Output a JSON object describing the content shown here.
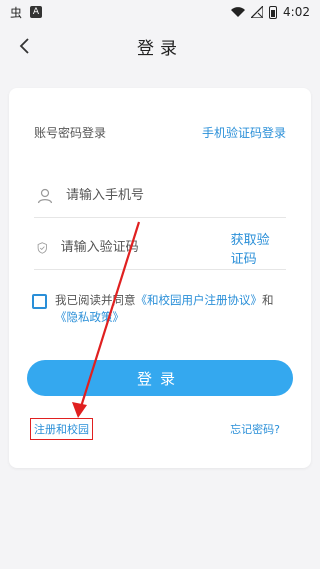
{
  "status_bar": {
    "time": "4:02",
    "left_glyph": "虫",
    "left_badge": "A"
  },
  "header": {
    "title": "登录",
    "back_icon": "chevron-left-icon"
  },
  "tabs": {
    "password_login": "账号密码登录",
    "sms_login": "手机验证码登录"
  },
  "phone_field": {
    "placeholder": "请输入手机号",
    "value": "",
    "icon": "user-icon"
  },
  "code_field": {
    "placeholder": "请输入验证码",
    "value": "",
    "icon": "shield-icon",
    "get_code": "获取验证码"
  },
  "agreement": {
    "prefix": "我已阅读并同意",
    "user_agreement": "《和校园用户注册协议》",
    "and": "和",
    "privacy_policy": "《隐私政策》",
    "checked": false
  },
  "login_button": "登录",
  "register_link": "注册和校园",
  "forgot_link": "忘记密码?",
  "colors": {
    "accent": "#34a8ef",
    "link": "#2a8fd8",
    "annotation": "#e02020"
  }
}
